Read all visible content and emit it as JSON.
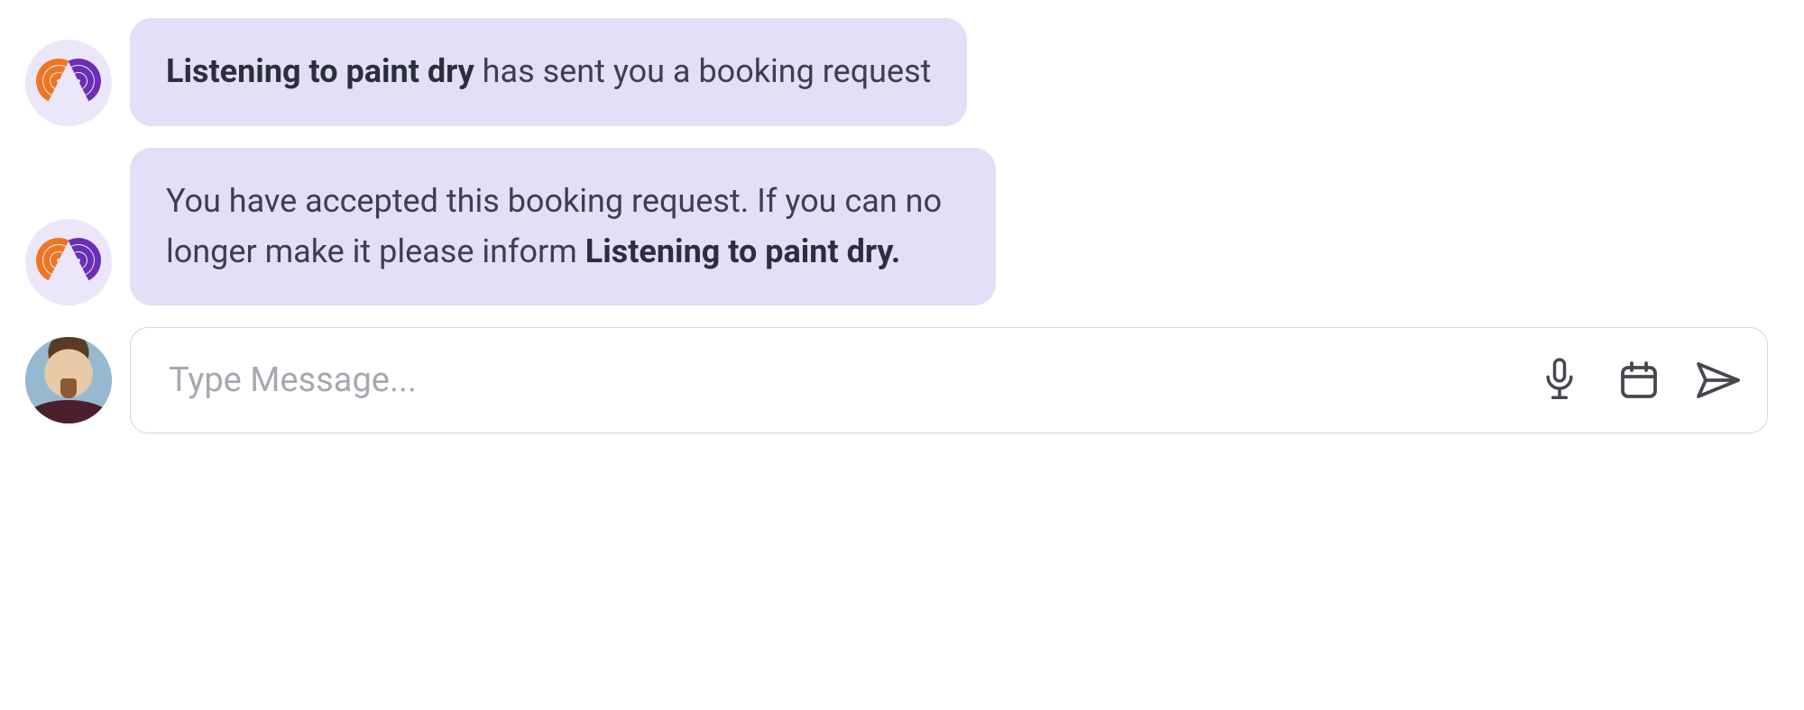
{
  "sender_name": "Listening to paint dry",
  "messages": [
    {
      "avatar": "system",
      "parts": [
        {
          "text": "Listening to paint dry",
          "bold": true
        },
        {
          "text": " has sent you a booking request",
          "bold": false
        }
      ]
    },
    {
      "avatar": "system",
      "parts": [
        {
          "text": "You have accepted this booking request. If you can no longer make it please inform ",
          "bold": false
        },
        {
          "text": "Listening to paint dry.",
          "bold": true
        }
      ]
    }
  ],
  "compose": {
    "placeholder": "Type Message...",
    "value": ""
  },
  "icons": {
    "mic": "microphone-icon",
    "calendar": "calendar-icon",
    "send": "send-icon"
  }
}
